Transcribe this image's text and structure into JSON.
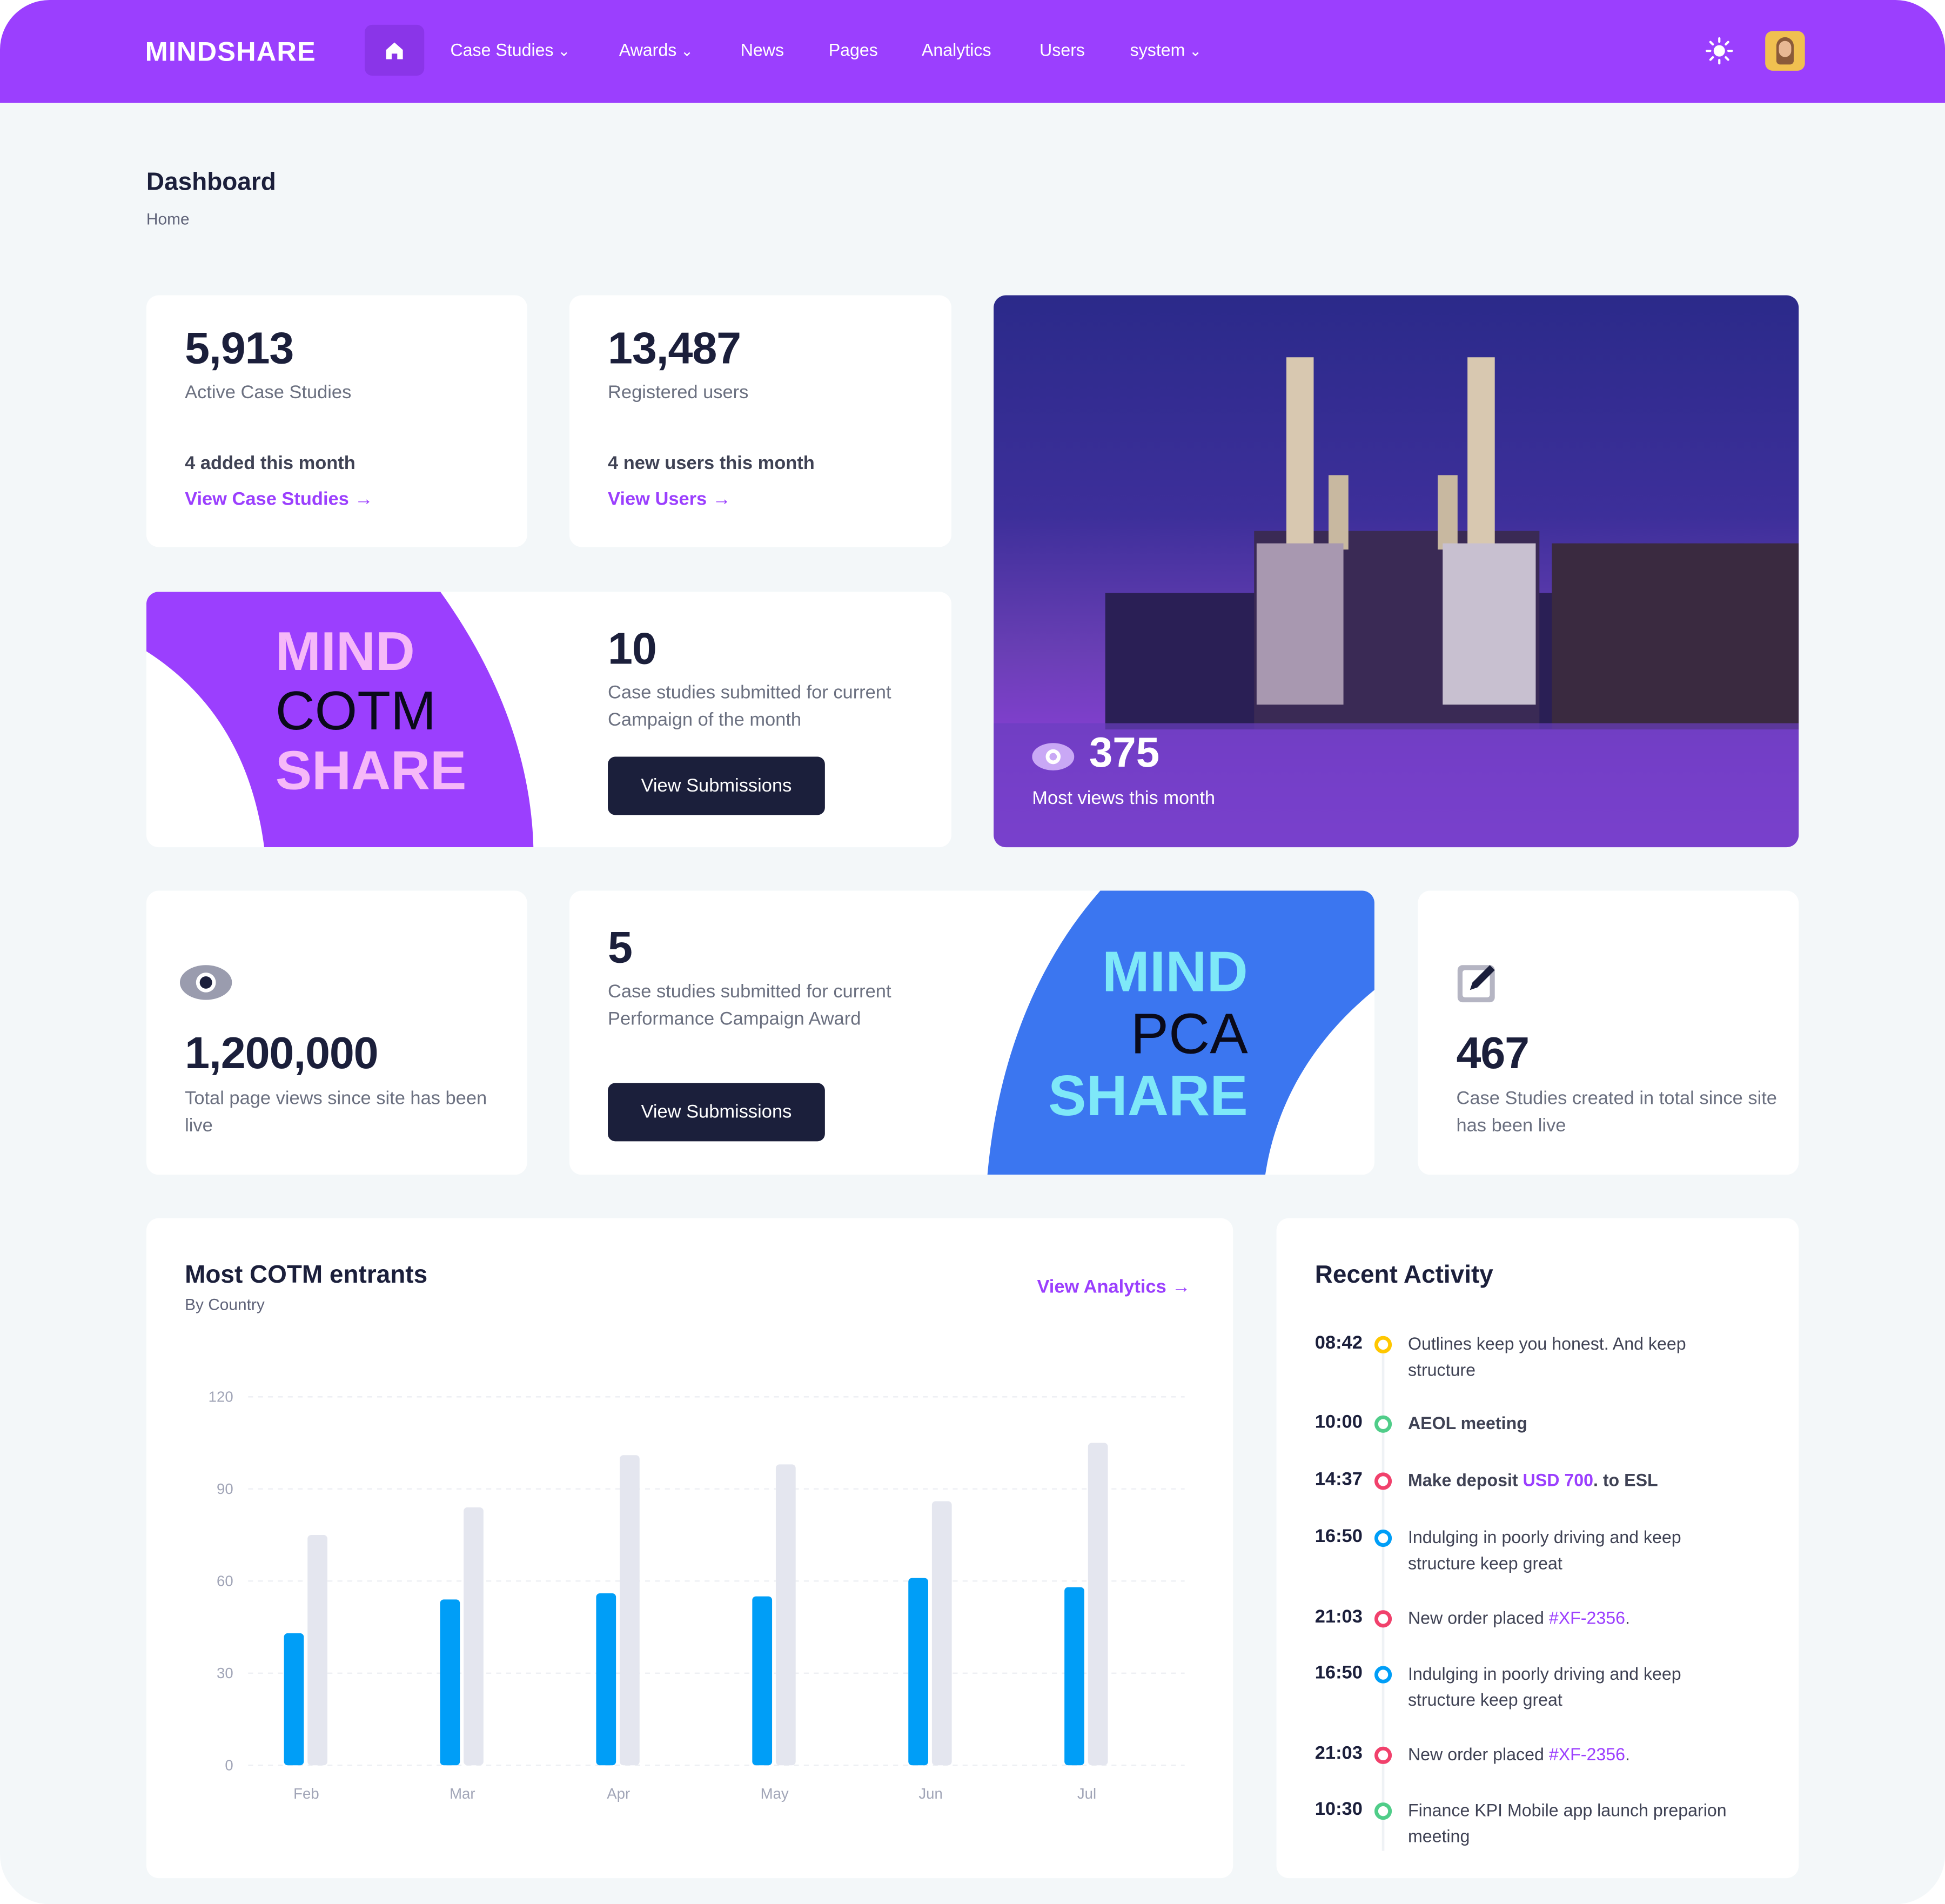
{
  "nav": {
    "logo": "MINDSHARE",
    "items": [
      "Case Studies",
      "Awards",
      "News",
      "Pages",
      "Analytics",
      "Users",
      "system"
    ],
    "dropdowns": [
      true,
      true,
      false,
      false,
      false,
      false,
      true
    ]
  },
  "header": {
    "title": "Dashboard",
    "breadcrumb": "Home"
  },
  "stats": {
    "case_studies": {
      "value": "5,913",
      "label": "Active Case Studies",
      "note": "4 added this month",
      "link": "View Case Studies"
    },
    "users": {
      "value": "13,487",
      "label": "Registered users",
      "note": "4 new users this month",
      "link": "View Users"
    },
    "views": {
      "value": "375",
      "label": "Most views this month"
    },
    "cotm": {
      "logo": [
        "MIND",
        "COTM",
        "SHARE"
      ],
      "value": "10",
      "label": "Case studies submitted for current Campaign of the month",
      "button": "View Submissions"
    },
    "page_views": {
      "value": "1,200,000",
      "label": "Total page views since site has been live"
    },
    "pca": {
      "logo": [
        "MIND",
        "PCA",
        "SHARE"
      ],
      "value": "5",
      "label": "Case studies submitted for current Performance Campaign Award",
      "button": "View Submissions"
    },
    "total": {
      "value": "467",
      "label": "Case Studies created in total since site has been live"
    }
  },
  "chart_card": {
    "title": "Most COTM entrants",
    "subtitle": "By Country",
    "link": "View Analytics"
  },
  "chart_data": {
    "type": "bar",
    "categories": [
      "Feb",
      "Mar",
      "Apr",
      "May",
      "Jun",
      "Jul"
    ],
    "series": [
      {
        "values": [
          43,
          54,
          56,
          55,
          61,
          58
        ],
        "color": "#009ef7"
      },
      {
        "values": [
          75,
          84,
          101,
          98,
          86,
          105
        ],
        "color": "#e4e6ef"
      }
    ],
    "ylim": [
      0,
      120
    ],
    "yticks": [
      "0",
      "30",
      "60",
      "90",
      "120"
    ],
    "grid": true
  },
  "activity": {
    "title": "Recent Activity",
    "items": [
      {
        "time": "08:42",
        "color": "#ffc700",
        "text": "Outlines keep you honest. And keep structure",
        "bold": false
      },
      {
        "time": "10:00",
        "color": "#50cd89",
        "text": "AEOL meeting",
        "bold": true
      },
      {
        "time": "14:37",
        "color": "#f1416c",
        "pre": "Make deposit ",
        "hl": "USD 700",
        "post": ". to ESL",
        "bold": true
      },
      {
        "time": "16:50",
        "color": "#009ef7",
        "text": "Indulging in poorly driving and keep structure keep great",
        "bold": false
      },
      {
        "time": "21:03",
        "color": "#f1416c",
        "pre": "New order placed ",
        "hl": "#XF-2356",
        "post": ".",
        "bold": false
      },
      {
        "time": "16:50",
        "color": "#009ef7",
        "text": "Indulging in poorly driving and keep structure keep great",
        "bold": false
      },
      {
        "time": "21:03",
        "color": "#f1416c",
        "pre": "New order placed ",
        "hl": "#XF-2356",
        "post": ".",
        "bold": false
      },
      {
        "time": "10:30",
        "color": "#50cd89",
        "text": "Finance KPI Mobile app launch preparion meeting",
        "bold": false
      }
    ]
  },
  "colors": {
    "brand": "#9b3ffe",
    "blue": "#3b76f0",
    "dark": "#1b1f3b"
  }
}
